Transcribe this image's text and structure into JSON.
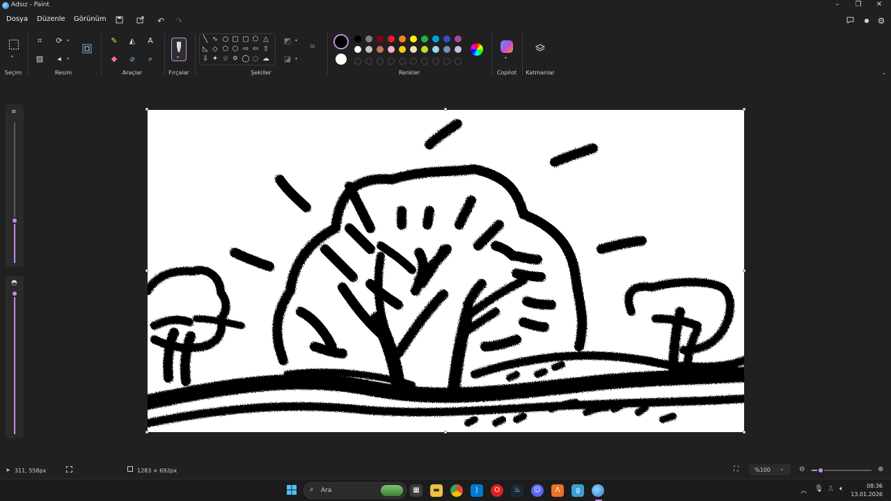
{
  "window": {
    "title": "Adsız - Paint"
  },
  "menu": {
    "file": "Dosya",
    "edit": "Düzenle",
    "view": "Görünüm"
  },
  "ribbon": {
    "groups": {
      "selection": "Seçim",
      "image": "Resim",
      "tools": "Araçlar",
      "brushes": "Fırçalar",
      "shapes": "Şekiller",
      "colors": "Renkler",
      "copilot": "Copilot",
      "layers": "Katmanlar"
    },
    "palette_row1": [
      "#000000",
      "#7f7f7f",
      "#880015",
      "#ed1c24",
      "#ff7f27",
      "#fff200",
      "#22b14c",
      "#00a2e8",
      "#3f48cc",
      "#a349a4"
    ],
    "palette_row2": [
      "#ffffff",
      "#c3c3c3",
      "#b97a57",
      "#ffaec9",
      "#ffc90e",
      "#efe4b0",
      "#b5e61d",
      "#99d9ea",
      "#7092be",
      "#c8bfe7"
    ],
    "accent": "#c88ee6"
  },
  "status": {
    "cursor_position": "311, 558px",
    "canvas_size": "1283 × 692px",
    "zoom": "%100",
    "brush_size_level": 0.3,
    "opacity_level": 1.0,
    "zoom_slider_level": 0.15
  },
  "taskbar": {
    "search_placeholder": "Ara",
    "time": "08:36",
    "date": "13.01.2026"
  }
}
